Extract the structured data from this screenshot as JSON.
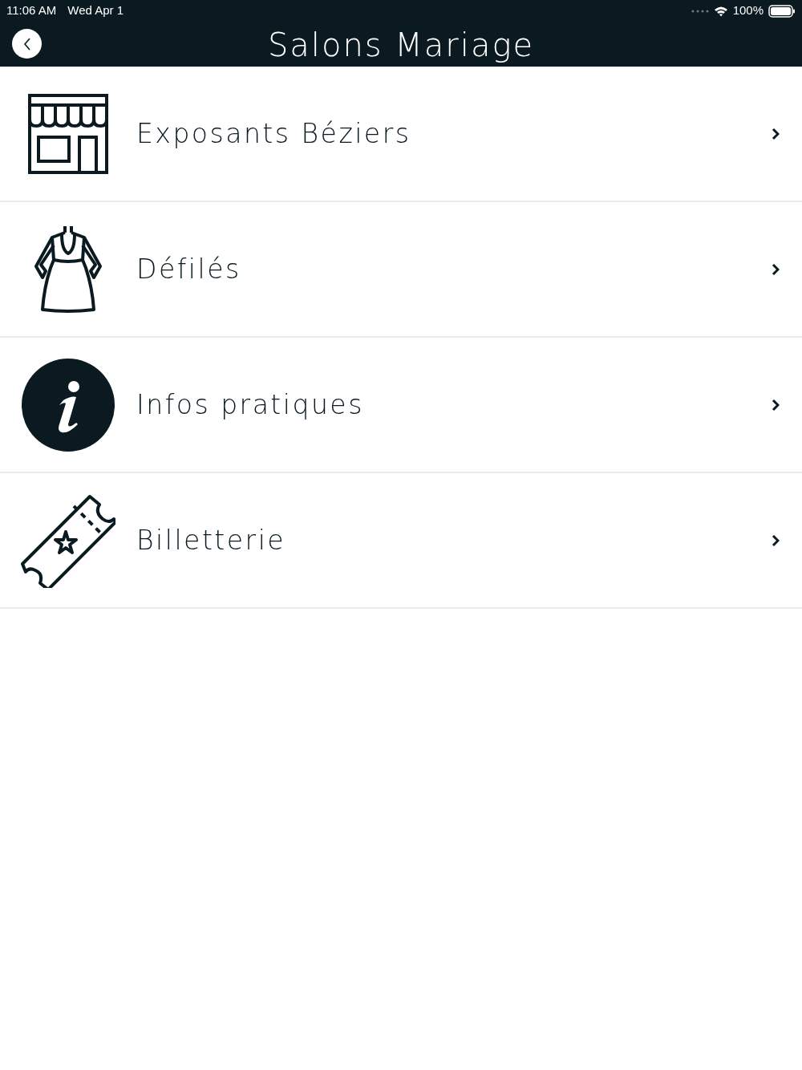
{
  "status_bar": {
    "time": "11:06 AM",
    "date": "Wed Apr 1",
    "battery": "100%"
  },
  "nav_bar": {
    "title": "Salons Mariage"
  },
  "menu": [
    {
      "label": "Exposants Béziers",
      "kind": "store"
    },
    {
      "label": "Défilés",
      "kind": "dress"
    },
    {
      "label": "Infos pratiques",
      "kind": "info"
    },
    {
      "label": "Billetterie",
      "kind": "ticket"
    }
  ]
}
